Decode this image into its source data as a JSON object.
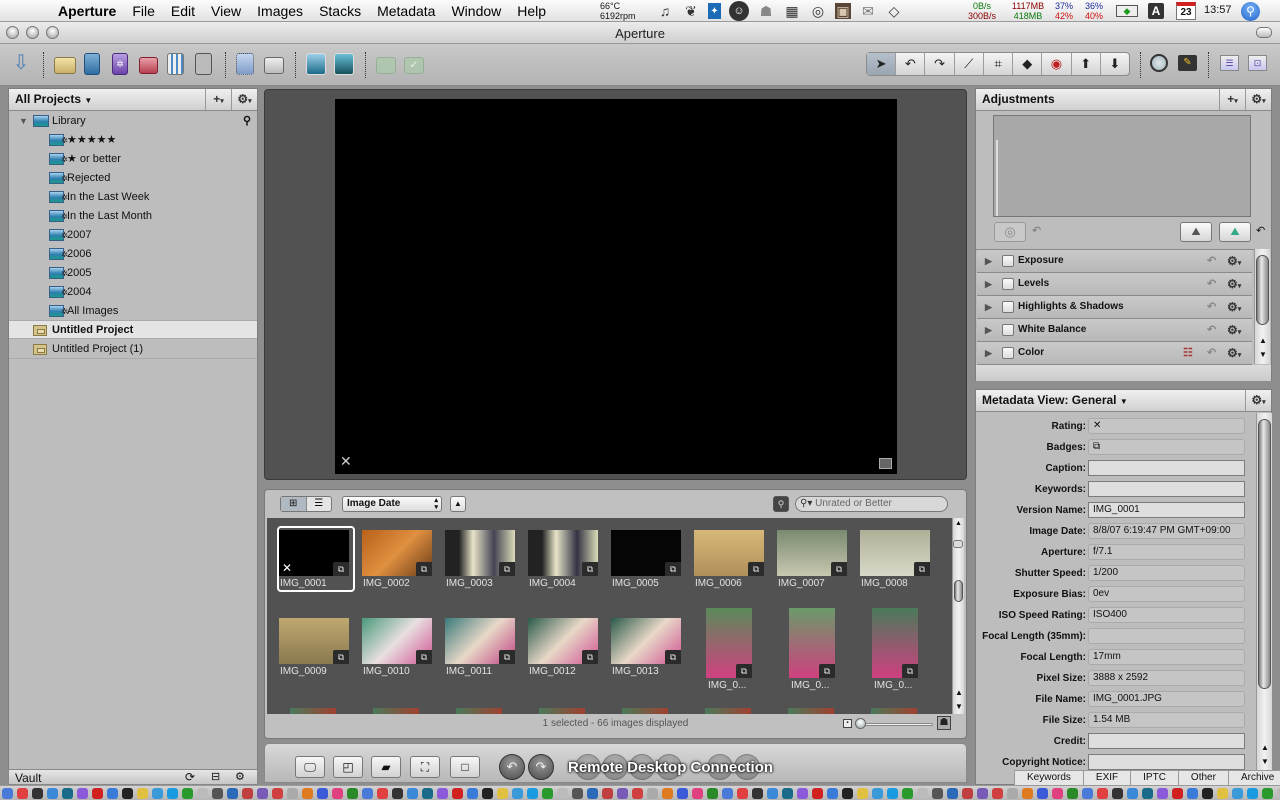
{
  "menubar": {
    "apple": "",
    "items": [
      "Aperture",
      "File",
      "Edit",
      "View",
      "Images",
      "Stacks",
      "Metadata",
      "Window",
      "Help"
    ],
    "temp": "66°C",
    "fan": "6192rpm",
    "net_in": "0B/s",
    "net_out": "300B/s",
    "mem_used": "1117MB",
    "mem_free": "418MB",
    "cpu1_a": "37%",
    "cpu1_b": "42%",
    "cpu2_a": "36%",
    "cpu2_b": "40%",
    "date_badge": "23",
    "clock": "13:57"
  },
  "window": {
    "title": "Aperture"
  },
  "projects_panel": {
    "title": "All Projects",
    "add_label": "+",
    "gear_label": "⚙",
    "library_label": "Library",
    "items": [
      {
        "label": "★★★★★"
      },
      {
        "label": "★  or  better"
      },
      {
        "label": "Rejected"
      },
      {
        "label": "In the Last Week"
      },
      {
        "label": "In the Last Month"
      },
      {
        "label": "2007"
      },
      {
        "label": "2006"
      },
      {
        "label": "2005"
      },
      {
        "label": "2004"
      },
      {
        "label": "All Images"
      }
    ],
    "projects": [
      {
        "label": "Untitled Project",
        "selected": true
      },
      {
        "label": "Untitled Project (1)",
        "selected": false
      }
    ],
    "vault_label": "Vault"
  },
  "viewer": {
    "reject_mark": "✕"
  },
  "browser": {
    "sort_value": "Image Date",
    "search_placeholder": "Unrated or Better",
    "status": "1 selected - 66 images displayed",
    "thumbnails": [
      {
        "name": "IMG_0001",
        "selected": true,
        "rejected": true
      },
      {
        "name": "IMG_0002"
      },
      {
        "name": "IMG_0003"
      },
      {
        "name": "IMG_0004"
      },
      {
        "name": "IMG_0005"
      },
      {
        "name": "IMG_0006"
      },
      {
        "name": "IMG_0007"
      },
      {
        "name": "IMG_0008"
      },
      {
        "name": "IMG_0009"
      },
      {
        "name": "IMG_0010"
      },
      {
        "name": "IMG_0011"
      },
      {
        "name": "IMG_0012"
      },
      {
        "name": "IMG_0013"
      },
      {
        "name": "IMG_0..."
      },
      {
        "name": "IMG_0..."
      },
      {
        "name": "IMG_0..."
      }
    ]
  },
  "adjustments": {
    "title": "Adjustments",
    "rows": [
      {
        "label": "Exposure"
      },
      {
        "label": "Levels"
      },
      {
        "label": "Highlights & Shadows"
      },
      {
        "label": "White Balance"
      },
      {
        "label": "Color"
      }
    ]
  },
  "metadata": {
    "title": "Metadata View: General",
    "fields": [
      {
        "label": "Rating:",
        "value": "✕"
      },
      {
        "label": "Badges:",
        "value": "⧉"
      },
      {
        "label": "Caption:",
        "value": ""
      },
      {
        "label": "Keywords:",
        "value": ""
      },
      {
        "label": "Version Name:",
        "value": "IMG_0001"
      },
      {
        "label": "Image Date:",
        "value": "8/8/07 6:19:47 PM GMT+09:00"
      },
      {
        "label": "Aperture:",
        "value": "f/7.1"
      },
      {
        "label": "Shutter Speed:",
        "value": "1/200"
      },
      {
        "label": "Exposure Bias:",
        "value": "0ev"
      },
      {
        "label": "ISO Speed Rating:",
        "value": "ISO400"
      },
      {
        "label": "Focal Length (35mm):",
        "value": ""
      },
      {
        "label": "Focal Length:",
        "value": "17mm"
      },
      {
        "label": "Pixel Size:",
        "value": "3888 x 2592"
      },
      {
        "label": "File Name:",
        "value": "IMG_0001.JPG"
      },
      {
        "label": "File Size:",
        "value": "1.54 MB"
      },
      {
        "label": "Credit:",
        "value": ""
      },
      {
        "label": "Copyright Notice:",
        "value": ""
      }
    ],
    "tabs": [
      "Keywords",
      "EXIF",
      "IPTC",
      "Other",
      "Archive"
    ]
  },
  "overlay": {
    "remote_desktop": "Remote Desktop Connection"
  },
  "colors": {
    "accent": "#2d7fe0",
    "viewer_bg": "#525252",
    "panel_bg": "#bdbdbd"
  }
}
